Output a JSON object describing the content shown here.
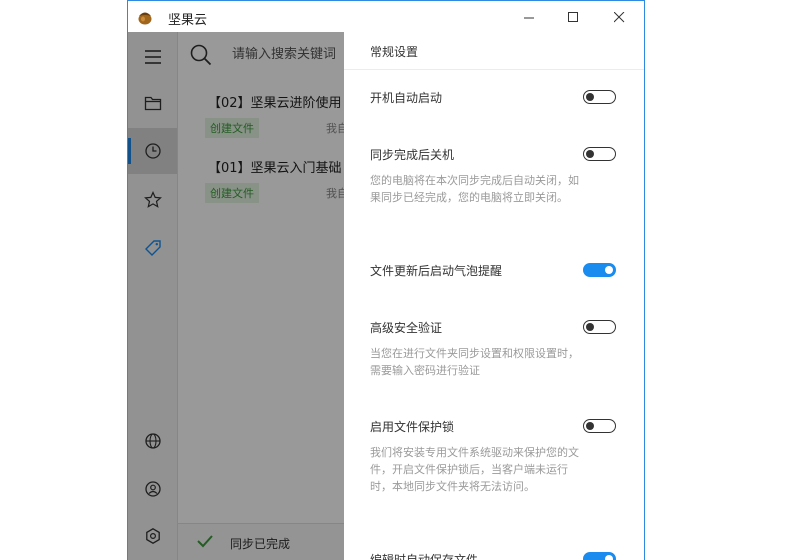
{
  "window": {
    "title": "坚果云"
  },
  "search": {
    "placeholder": "请输入搜索关键词"
  },
  "files": [
    {
      "title": "【02】坚果云进阶使用",
      "tag": "创建文件",
      "meta": "我自"
    },
    {
      "title": "【01】坚果云入门基础",
      "tag": "创建文件",
      "meta": "我自"
    }
  ],
  "status": {
    "text": "同步已完成"
  },
  "panel": {
    "title": "常规设置",
    "settings": [
      {
        "label": "开机自动启动",
        "on": false
      },
      {
        "label": "同步完成后关机",
        "desc": "您的电脑将在本次同步完成后自动关闭，如果同步已经完成，您的电脑将立即关闭。",
        "on": false
      },
      {
        "label": "文件更新后启动气泡提醒",
        "on": true
      },
      {
        "label": "高级安全验证",
        "desc": "当您在进行文件夹同步设置和权限设置时，需要输入密码进行验证",
        "on": false
      },
      {
        "label": "启用文件保护锁",
        "desc": "我们将安装专用文件系统驱动来保护您的文件，开启文件保护锁后，当客户端未运行时，本地同步文件夹将无法访问。",
        "on": false
      },
      {
        "label": "编辑时自动保存文件",
        "on": true
      }
    ]
  },
  "icons": {
    "rail": [
      "menu-icon",
      "folder-icon",
      "recent-clock-icon",
      "star-icon",
      "tag-icon",
      "globe-icon",
      "user-icon",
      "settings-icon"
    ]
  },
  "colors": {
    "accent": "#1a8cf0",
    "tag_green": "#3f9a3f"
  }
}
